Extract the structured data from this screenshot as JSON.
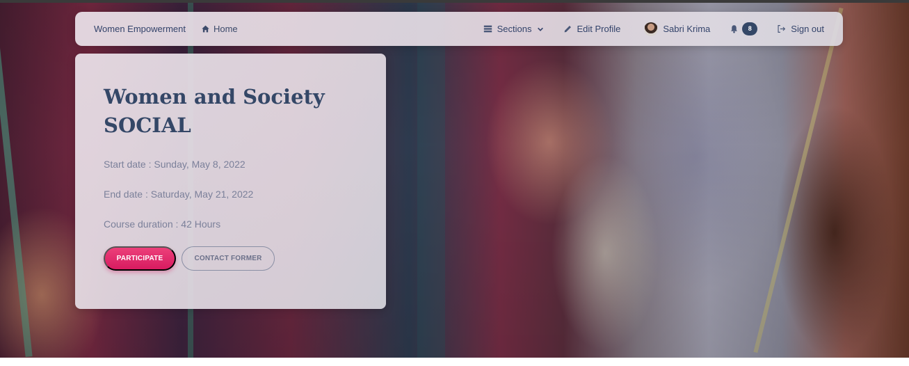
{
  "navbar": {
    "brand": "Women Empowerment",
    "home": "Home",
    "sections": "Sections",
    "edit_profile": "Edit Profile",
    "user_name": "Sabri Krima",
    "notifications_count": "8",
    "sign_out": "Sign out"
  },
  "course": {
    "title_line1": "Women and Society",
    "title_line2": "SOCIAL",
    "start_date": "Start date : Sunday, May 8, 2022",
    "end_date": "End date : Saturday, May 21, 2022",
    "duration": "Course duration : 42 Hours",
    "participate_label": "PARTICIPATE",
    "contact_label": "CONTACT FORMER"
  },
  "colors": {
    "primary": "#e91e63",
    "heading": "#344767",
    "muted_text": "#7b809a",
    "badge": "#344767"
  }
}
